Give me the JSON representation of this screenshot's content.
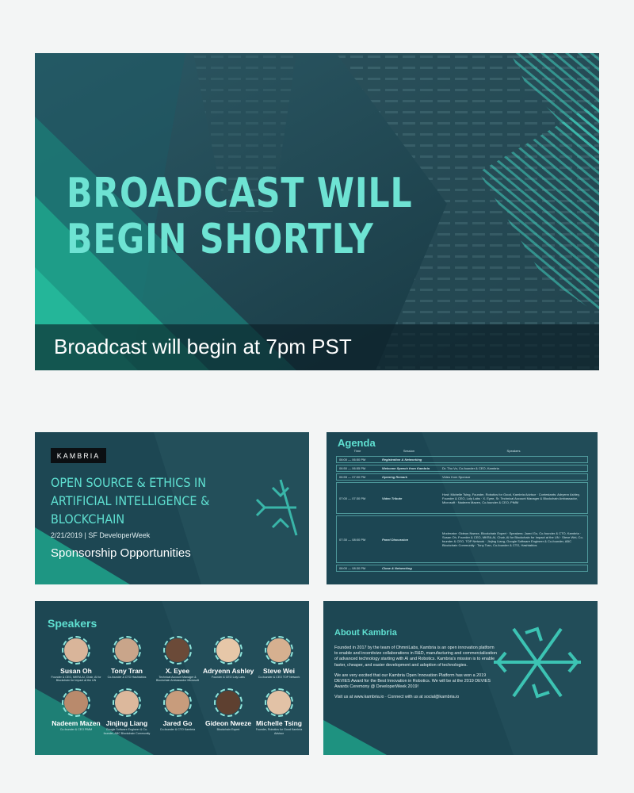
{
  "hero": {
    "title_line1": "BROADCAST WILL",
    "title_line2": "BEGIN SHORTLY",
    "caption": "Broadcast will begin at 7pm PST"
  },
  "colors": {
    "accent": "#5fe0d1",
    "teal_dark": "#1b4a57",
    "teal_bright": "#1fa58c"
  },
  "title_slide": {
    "logo": "KAMBRIA",
    "title_lines": [
      "OPEN SOURCE & ETHICS IN",
      "ARTIFICIAL INTELLIGENCE &",
      "BLOCKCHAIN"
    ],
    "meta": "2/21/2019 | SF DeveloperWeek",
    "subtitle": "Sponsorship Opportunities"
  },
  "agenda": {
    "heading": "Agenda",
    "columns": [
      "Time",
      "Session",
      "Speakers"
    ],
    "rows": [
      {
        "time": "06:00 — 06:50 PM",
        "session": "Registration & Networking",
        "speakers": ""
      },
      {
        "time": "06:50 — 06:55 PM",
        "session": "Welcome Speech from Kambria",
        "speakers": "Dr. Thu Vo, Co-founder & CEO, Kambria"
      },
      {
        "time": "06:55 — 07:00 PM",
        "session": "Opening Remark",
        "speakers": "Video from Sponsor"
      },
      {
        "time": "07:00 — 07:30 PM",
        "session": "Video Tribute",
        "speakers": "Host: Michelle Tsing, Founder, Robotics for Good, Kambria Advisor · Contestants: Adryenn Ashley, Founder & CEO, Loly Labs · X. Eyee, Sr. Technical Account Manager & Blockchain Ambassador, Microsoft · Nadeem Mazen, Co-founder & CEO, PiMM"
      },
      {
        "time": "07:30 — 08:00 PM",
        "session": "Panel Discussion",
        "speakers": "Moderator: Gideon Nweze, Blockchain Expert · Speakers: Jared Go, Co-founder & CTO, Kambria · Susan Oh, Founder & CEO, MKRA.AI, Chair, AI for Blockchain for Impact at the UN · Steve Wei, Co-founder & CEO, TOP Network · Jinjing Liang, Google Software Engineer & Co-founder, ABC Blockchain Community · Tony Tran, Co-founder & CTO, Hashtablos"
      },
      {
        "time": "08:00 — 08:30 PM",
        "session": "Close & Networking",
        "speakers": ""
      }
    ]
  },
  "speakers": {
    "heading": "Speakers",
    "people": [
      {
        "name": "Susan Oh",
        "role": "Founder & CEO, MKRA.AI, Chair, AI for Blockchain for Impact at the UN",
        "tone": "#d9b59a"
      },
      {
        "name": "Tony Tran",
        "role": "Co-founder & CTO Hashtablos",
        "tone": "#c9a58a"
      },
      {
        "name": "X. Eyee",
        "role": "Technical Account Manager & Blockchain Ambassador Microsoft",
        "tone": "#6b4a38"
      },
      {
        "name": "Adryenn Ashley",
        "role": "Founder & CEO Loly Labs",
        "tone": "#e6c7a8"
      },
      {
        "name": "Steve Wei",
        "role": "Co-founder & CEO TOP Network",
        "tone": "#d6b090"
      },
      {
        "name": "Nadeem Mazen",
        "role": "Co-founder & CEO PiMM",
        "tone": "#b98a6c"
      },
      {
        "name": "Jinjing Liang",
        "role": "Google Software Engineer & Co-founder, ABC Blockchain Community",
        "tone": "#dcb89c"
      },
      {
        "name": "Jared Go",
        "role": "Co-founder & CTO Kambria",
        "tone": "#c89c7c"
      },
      {
        "name": "Gideon Nweze",
        "role": "Blockchain Expert",
        "tone": "#5e4030"
      },
      {
        "name": "Michelle Tsing",
        "role": "Founder, Robotics for Good Kambria Advisor",
        "tone": "#e2c2a6"
      }
    ]
  },
  "about": {
    "heading": "About Kambria",
    "paragraph1": "Founded in 2017 by the team of OhmniLabs, Kambria is an open innovation platform to enable and incentivize collaborations in R&D, manufacturing and commercialization of advanced technology starting with AI and Robotics. Kambria's mission is to enable faster, cheaper, and easier development and adoption of technologies.",
    "paragraph2": "We are very excited that our Kambria Open Innovation Platform has won a 2019 DEVIES Award for the Best Innovation in Robotics. We will be at the 2019 DEVIES Awards Ceremony @ DeveloperWeek 2019!",
    "paragraph3": "Visit us at www.kambria.io · Connect with us at social@kambria.io"
  }
}
